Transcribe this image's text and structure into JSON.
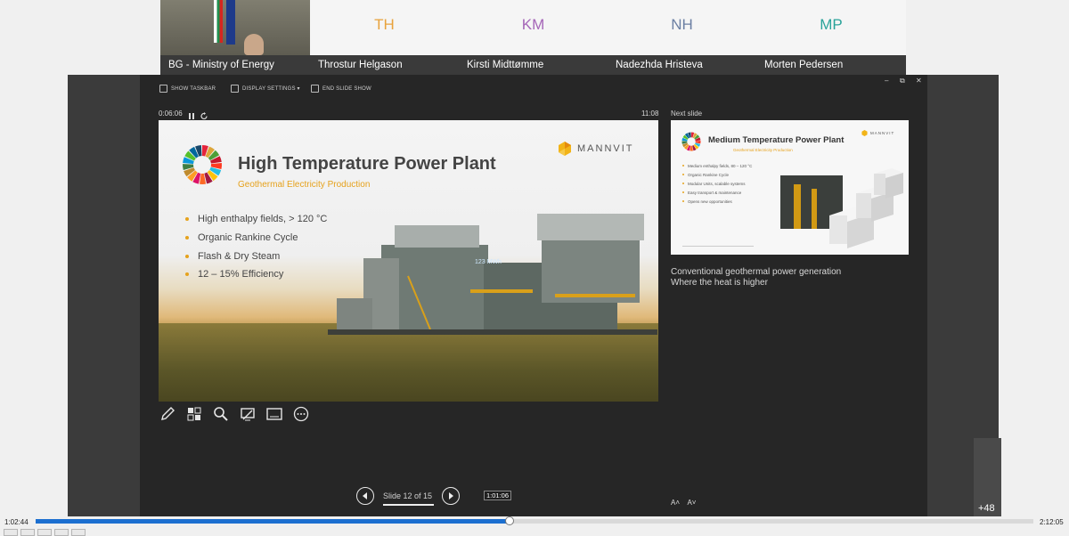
{
  "participants": [
    {
      "name": "BG - Ministry of Energy",
      "type": "video"
    },
    {
      "name": "Throstur Helgason",
      "initials": "TH",
      "color": "#e8a23c"
    },
    {
      "name": "Kirsti Midttømme",
      "initials": "KM",
      "color": "#a566b8"
    },
    {
      "name": "Nadezhda Hristeva",
      "initials": "NH",
      "color": "#6b7fa3"
    },
    {
      "name": "Morten Pedersen",
      "initials": "MP",
      "color": "#2aa39a"
    }
  ],
  "presenter": {
    "toolbar": {
      "show_taskbar": "SHOW TASKBAR",
      "display_settings": "DISPLAY SETTINGS ▾",
      "end_slide_show": "END SLIDE SHOW"
    },
    "window_controls": {
      "minimize": "–",
      "restore": "⧉",
      "close": "✕"
    },
    "elapsed": "0:06:06",
    "clock": "11:08",
    "next_slide_label": "Next slide",
    "current_slide": {
      "title": "High Temperature Power Plant",
      "subtitle": "Geothermal Electricity Production",
      "logo_text": "MANNVIT",
      "bullets": [
        "High enthalpy fields, > 120 °C",
        "Organic Rankine Cycle",
        "Flash & Dry Steam",
        "12 – 15% Efficiency"
      ],
      "image_label": "123 MWh"
    },
    "next_slide": {
      "title": "Medium Temperature Power Plant",
      "subtitle": "Geothermal Electricity Production",
      "logo_text": "MANNVIT",
      "bullets": [
        "Medium enthalpy fields, 80 – 120 °C",
        "Organic Rankine Cycle",
        "Modular Units, scalable systems",
        "Easy transport & maintenance",
        "Opens new opportunities"
      ]
    },
    "notes": [
      "Conventional geothermal power generation",
      "Where the heat is higher"
    ],
    "font_buttons": {
      "larger": "A˄",
      "smaller": "A˅"
    },
    "slide_counter": "Slide 12 of 15",
    "tools": [
      "pen-icon",
      "slides-grid-icon",
      "zoom-icon",
      "pointer-icon",
      "subtitles-icon",
      "more-options-icon"
    ]
  },
  "more_participants": "+48",
  "player": {
    "current_time": "1:02:44",
    "total_time": "2:12:05",
    "hover_time": "1:01:06",
    "progress": 0.475
  }
}
